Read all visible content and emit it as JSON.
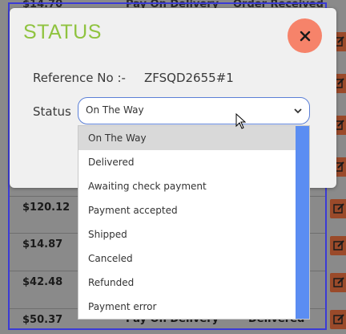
{
  "background": {
    "top_strip": {
      "price": "$14.70",
      "pay": "Pay On Delivery",
      "status": "Order Received"
    },
    "rows": [
      {
        "price": "$120.12",
        "pay": "",
        "status": ""
      },
      {
        "price": "$14.87",
        "pay": "",
        "status": ""
      },
      {
        "price": "$42.48",
        "pay": "",
        "status": ""
      },
      {
        "price": "$50.37",
        "pay": "Pay On Delivery",
        "status": "Delivered"
      }
    ]
  },
  "modal": {
    "title": "STATUS",
    "close_icon": "close-icon",
    "reference_label": "Reference No :-",
    "reference_value": "ZFSQD2655#1",
    "status_label": "Status",
    "status_selected": "On The Way"
  },
  "dropdown": {
    "options": [
      "On The Way",
      "Delivered",
      "Awaiting check payment",
      "Payment accepted",
      "Shipped",
      "Canceled",
      "Refunded",
      "Payment error"
    ],
    "selected_index": 0
  },
  "colors": {
    "title": "#8fc33f",
    "close_button": "#f6836a",
    "scrollbar": "#5b8df2",
    "select_border": "#5b7fd6"
  }
}
